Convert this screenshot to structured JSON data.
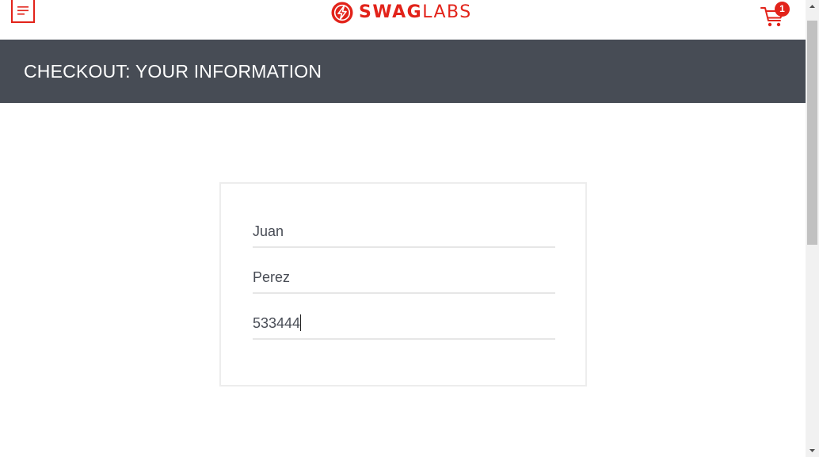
{
  "header": {
    "logo_bold": "SWAG",
    "logo_light": "LABS",
    "menu_icon": "hamburger-menu-icon",
    "cart_icon": "shopping-cart-icon",
    "cart_count": "1"
  },
  "subheader": {
    "title": "CHECKOUT: YOUR INFORMATION"
  },
  "form": {
    "first_name": "Juan",
    "last_name": "Perez",
    "postal_code": "533444"
  },
  "colors": {
    "brand": "#e2231a",
    "title_bar": "#474c55",
    "text": "#484c55"
  }
}
